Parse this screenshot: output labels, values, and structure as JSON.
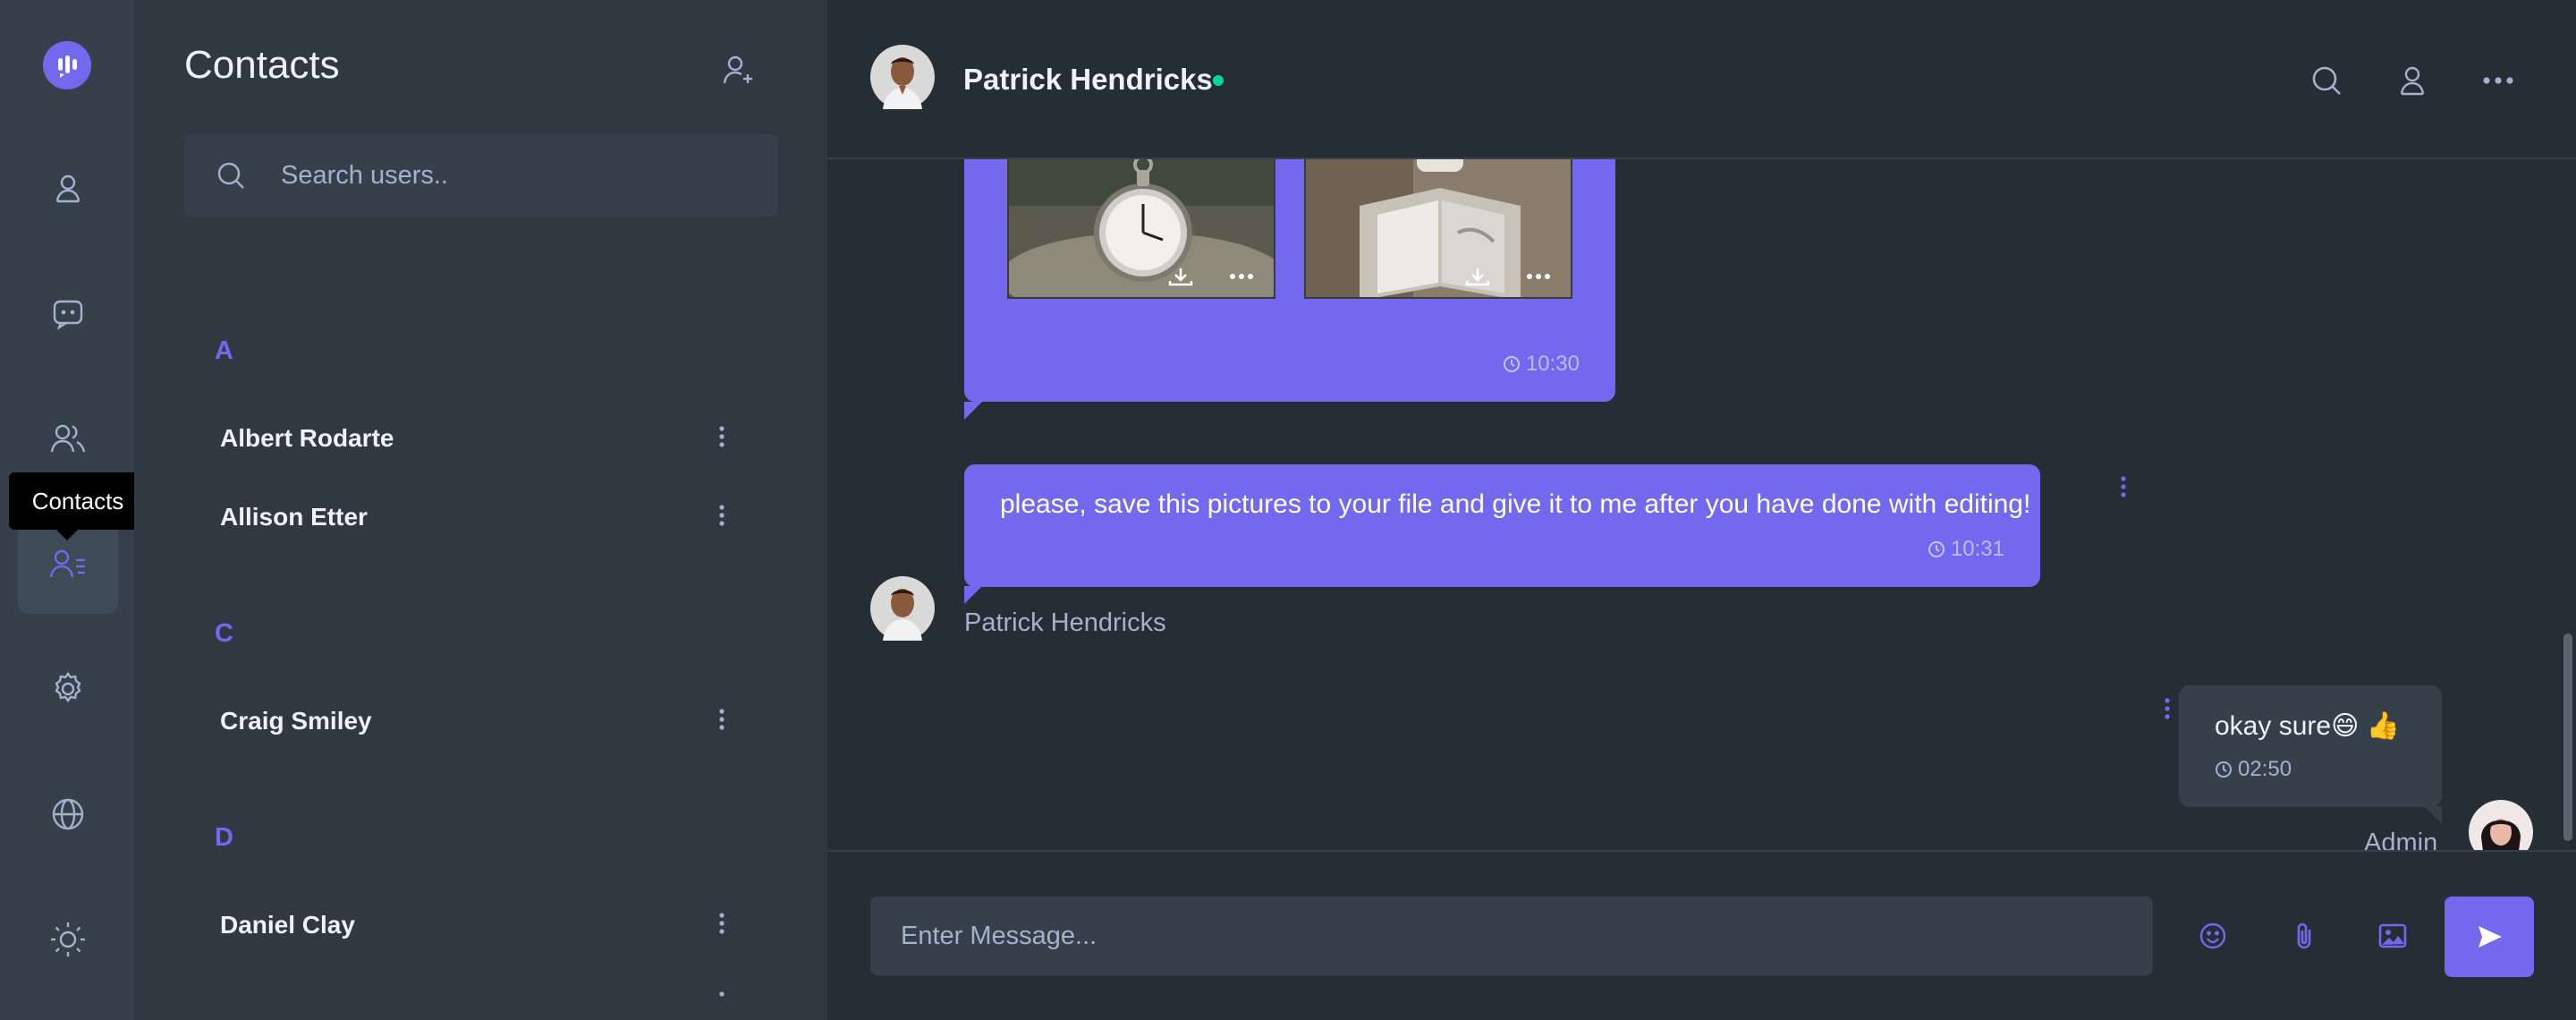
{
  "rail": {
    "tooltip": "Contacts",
    "active_item": "contacts",
    "items": [
      "profile",
      "chats",
      "groups",
      "contacts",
      "settings",
      "language",
      "theme"
    ]
  },
  "contacts": {
    "title": "Contacts",
    "search_placeholder": "Search users..",
    "groups": [
      {
        "letter": "A",
        "names": [
          "Albert Rodarte",
          "Allison Etter"
        ]
      },
      {
        "letter": "C",
        "names": [
          "Craig Smiley"
        ]
      },
      {
        "letter": "D",
        "names": [
          "Daniel Clay"
        ]
      }
    ]
  },
  "chat": {
    "contact_name": "Patrick Hendricks",
    "status": "online",
    "messages": [
      {
        "type": "images",
        "time": "10:30"
      },
      {
        "type": "text",
        "text": "please, save this pictures to your file and give it to me after you have done with editing!",
        "time": "10:31",
        "sender": "Patrick Hendricks"
      },
      {
        "type": "text",
        "text": "okay sure😄 👍",
        "time": "02:50",
        "sender": "Admin"
      }
    ],
    "composer_placeholder": "Enter Message..."
  },
  "colors": {
    "accent": "#7269ef",
    "online": "#06d6a0",
    "rail_bg": "#36404a",
    "panel_bg": "#303841",
    "chat_bg": "#262e35"
  }
}
